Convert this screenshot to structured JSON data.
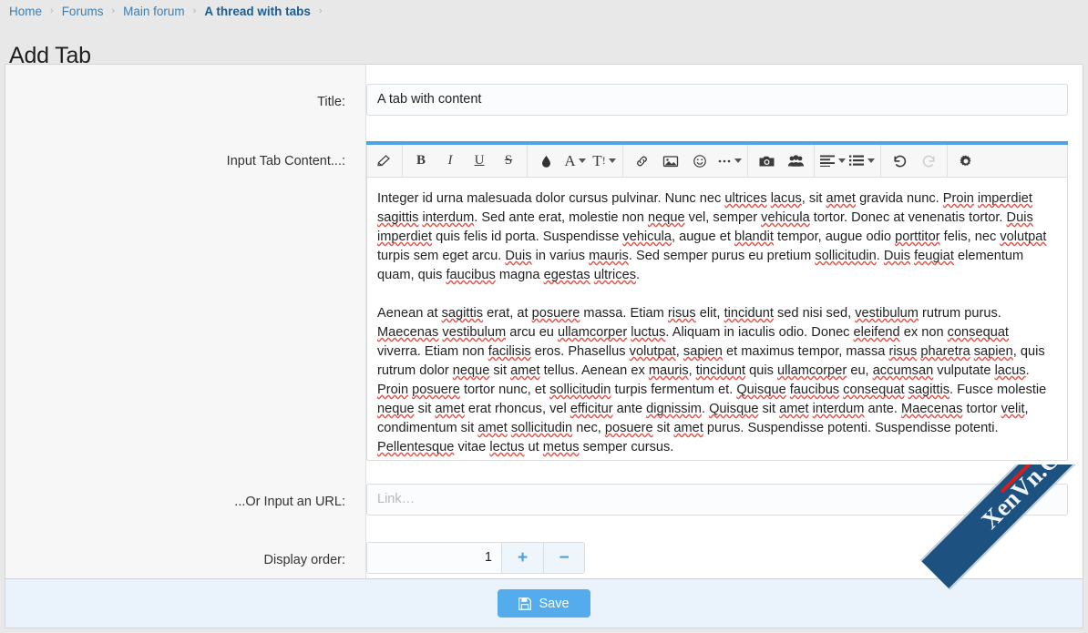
{
  "breadcrumb": {
    "items": [
      {
        "label": "Home",
        "current": false
      },
      {
        "label": "Forums",
        "current": false
      },
      {
        "label": "Main forum",
        "current": false
      },
      {
        "label": "A thread with tabs",
        "current": true
      }
    ],
    "separator": "›"
  },
  "page": {
    "title": "Add Tab"
  },
  "form": {
    "title_row": {
      "label": "Title:",
      "value": "A tab with content"
    },
    "editor_row": {
      "label": "Input Tab Content...:",
      "toolbar": [
        {
          "name": "remove-formatting-icon",
          "glyph": "eraser",
          "dropdown": false,
          "disabled": false
        },
        {
          "name": "bold-button",
          "glyph": "B",
          "dropdown": false,
          "disabled": false
        },
        {
          "name": "italic-button",
          "glyph": "I",
          "dropdown": false,
          "disabled": false
        },
        {
          "name": "underline-button",
          "glyph": "U",
          "dropdown": false,
          "disabled": false
        },
        {
          "name": "strikethrough-button",
          "glyph": "S",
          "dropdown": false,
          "disabled": false
        },
        {
          "name": "text-color-button",
          "glyph": "droplet",
          "dropdown": false,
          "disabled": false
        },
        {
          "name": "font-family-button",
          "glyph": "A",
          "dropdown": true,
          "disabled": false
        },
        {
          "name": "font-size-button",
          "glyph": "T!",
          "dropdown": true,
          "disabled": false
        },
        {
          "name": "insert-link-button",
          "glyph": "link",
          "dropdown": false,
          "disabled": false
        },
        {
          "name": "insert-image-button",
          "glyph": "image",
          "dropdown": false,
          "disabled": false
        },
        {
          "name": "emoji-button",
          "glyph": "smiley",
          "dropdown": false,
          "disabled": false
        },
        {
          "name": "more-options-button",
          "glyph": "ellipsis",
          "dropdown": true,
          "disabled": false
        },
        {
          "name": "camera-button",
          "glyph": "camera",
          "dropdown": false,
          "disabled": false
        },
        {
          "name": "mention-users-button",
          "glyph": "users",
          "dropdown": false,
          "disabled": false
        },
        {
          "name": "align-button",
          "glyph": "align",
          "dropdown": true,
          "disabled": false
        },
        {
          "name": "list-button",
          "glyph": "list",
          "dropdown": true,
          "disabled": false
        },
        {
          "name": "undo-button",
          "glyph": "undo",
          "dropdown": false,
          "disabled": false
        },
        {
          "name": "redo-button",
          "glyph": "redo",
          "dropdown": false,
          "disabled": true
        },
        {
          "name": "editor-settings-button",
          "glyph": "gear",
          "dropdown": false,
          "disabled": false
        }
      ],
      "paragraphs": [
        "Integer id urna malesuada dolor cursus pulvinar. Nunc nec ultrices lacus, sit amet gravida nunc. Proin imperdiet sagittis interdum. Sed ante erat, molestie non neque vel, semper vehicula tortor. Donec at venenatis tortor. Duis imperdiet quis felis id porta. Suspendisse vehicula, augue et blandit tempor, augue odio porttitor felis, nec volutpat turpis sem eget arcu. Duis in varius mauris. Sed semper purus eu pretium sollicitudin. Duis feugiat elementum quam, quis faucibus magna egestas ultrices.",
        "Aenean at sagittis erat, at posuere massa. Etiam risus elit, tincidunt sed nisi sed, vestibulum rutrum purus. Maecenas vestibulum arcu eu ullamcorper luctus. Aliquam in iaculis odio. Donec eleifend ex non consequat viverra. Etiam non facilisis eros. Phasellus volutpat, sapien et maximus tempor, massa risus pharetra sapien, quis rutrum dolor neque sit amet tellus. Aenean ex mauris, tincidunt quis ullamcorper eu, accumsan vulputate lacus. Proin posuere tortor nunc, et sollicitudin turpis fermentum et. Quisque faucibus consequat sagittis. Fusce molestie neque sit amet erat rhoncus, vel efficitur ante dignissim. Quisque sit amet interdum ante. Maecenas tortor velit, condimentum sit amet sollicitudin nec, posuere sit amet purus. Suspendisse potenti. Suspendisse potenti. Pellentesque vitae lectus ut metus semper cursus."
      ],
      "misspelled_words": [
        "ultrices",
        "lacus",
        "amet",
        "Proin",
        "imperdiet",
        "sagittis",
        "neque",
        "vehicula",
        "Duis",
        "blandit",
        "porttitor",
        "volutpat",
        "mauris",
        "sollicitudin",
        "feugiat",
        "faucibus",
        "egestas",
        "posuere",
        "risus",
        "tincidunt",
        "vestibulum",
        "Maecenas",
        "ullamcorper",
        "luctus",
        "eleifend",
        "consequat",
        "facilisis",
        "sapien",
        "pharetra",
        "accumsan",
        "Quisque",
        "efficitur",
        "dignissim",
        "interdum",
        "velit",
        "Pellentesque",
        "lectus",
        "metus"
      ]
    },
    "url_row": {
      "label": "...Or Input an URL:",
      "placeholder": "Link…",
      "value": ""
    },
    "order_row": {
      "label": "Display order:",
      "value": "1",
      "increment_label": "+",
      "decrement_label": "−"
    }
  },
  "footer": {
    "save_label": "Save"
  },
  "watermark": {
    "text": "XenVn.Com"
  },
  "colors": {
    "accent_blue": "#4fa3e3",
    "save_button": "#54aced",
    "link_blue": "#3f7fae",
    "current_crumb": "#1c5d8f",
    "footer_bg": "#eaf2fb",
    "watermark_ribbon": "#1d5180",
    "spellcheck_underline": "#e0564d"
  }
}
